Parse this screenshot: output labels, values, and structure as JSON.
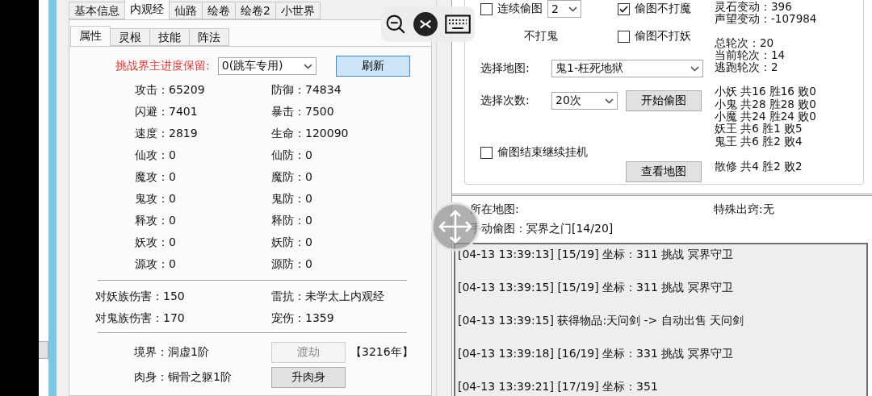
{
  "main_tabs": [
    {
      "label": "基本信息",
      "selected": false
    },
    {
      "label": "内观经",
      "selected": true
    },
    {
      "label": "仙路",
      "selected": false
    },
    {
      "label": "绘卷",
      "selected": false
    },
    {
      "label": "绘卷2",
      "selected": false
    },
    {
      "label": "小世界",
      "selected": false
    }
  ],
  "sub_tabs": [
    {
      "label": "属性",
      "selected": true
    },
    {
      "label": "灵根",
      "selected": false
    },
    {
      "label": "技能",
      "selected": false
    },
    {
      "label": "阵法",
      "selected": false
    }
  ],
  "progress": {
    "label": "挑战界主进度保留:",
    "value": "0(跳车专用)",
    "button": "刷新"
  },
  "stats": [
    {
      "left": "攻击：65209",
      "right": "防御：74834"
    },
    {
      "left": "闪避：7401",
      "right": "暴击：7500"
    },
    {
      "left": "速度：2819",
      "right": "生命：120090"
    },
    {
      "left": "仙攻：0",
      "right": "仙防：0"
    },
    {
      "left": "魔攻：0",
      "right": "魔防：0"
    },
    {
      "left": "鬼攻：0",
      "right": "鬼防：0"
    },
    {
      "left": "释攻：0",
      "right": "释防：0"
    },
    {
      "left": "妖攻：0",
      "right": "妖防：0"
    },
    {
      "left": "源攻：0",
      "right": "源防：0"
    }
  ],
  "damage": [
    {
      "left": "对妖族伤害：150",
      "right": "雷抗：未学太上内观经"
    },
    {
      "left": "对鬼族伤害：170",
      "right": "宠伤：1359"
    }
  ],
  "cultivation": [
    {
      "label": "境界：洞虚1阶",
      "button": "渡劫",
      "disabled": true,
      "note": "【3216年】"
    },
    {
      "label": "肉身：铜骨之躯1阶",
      "button": "升肉身",
      "disabled": false
    }
  ],
  "options": [
    {
      "label": "连续偷图",
      "checked": false,
      "select": "2"
    },
    {
      "label": "偷图不打魔",
      "checked": true
    },
    {
      "label": "不打鬼"
    },
    {
      "label": "偷图不打妖",
      "checked": false
    }
  ],
  "map_select": {
    "label": "选择地图:",
    "value": "鬼1-枉死地狱"
  },
  "count_select": {
    "label": "选择次数:",
    "value": "20次",
    "button": "开始偷图"
  },
  "continue_idle": {
    "label": "偷图结束继续挂机",
    "checked": false
  },
  "view_map_button": "查看地图",
  "summary": [
    "灵石变动：396",
    "声望变动：-107984"
  ],
  "rounds": [
    "总轮次：20",
    "当前轮次：14",
    "逃跑轮次：2"
  ],
  "battles": [
    "小妖 共16 胜16 败0",
    "小鬼 共28 胜28 败0",
    "小魔 共24 胜24 败0",
    "妖王 共6 胜1 败5",
    "鬼王 共6 胜2 败4"
  ],
  "other_battles": [
    "散修 共4 胜2 败2"
  ],
  "location": {
    "map_label": "所在地图:",
    "special": "特殊出窍:无",
    "manual": "手动偷图：冥界之门[14/20]"
  },
  "log": [
    "[04-13 13:39:13] [15/19] 坐标：311 挑战 冥界守卫",
    "[04-13 13:39:15] [15/19] 坐标：311 挑战 冥界守卫",
    "[04-13 13:39:15] 获得物品:天问剑 -> 自动出售 天问剑",
    "[04-13 13:39:18] [16/19] 坐标：331 挑战 冥界守卫",
    "[04-13 13:39:21] [17/19] 坐标：351"
  ]
}
